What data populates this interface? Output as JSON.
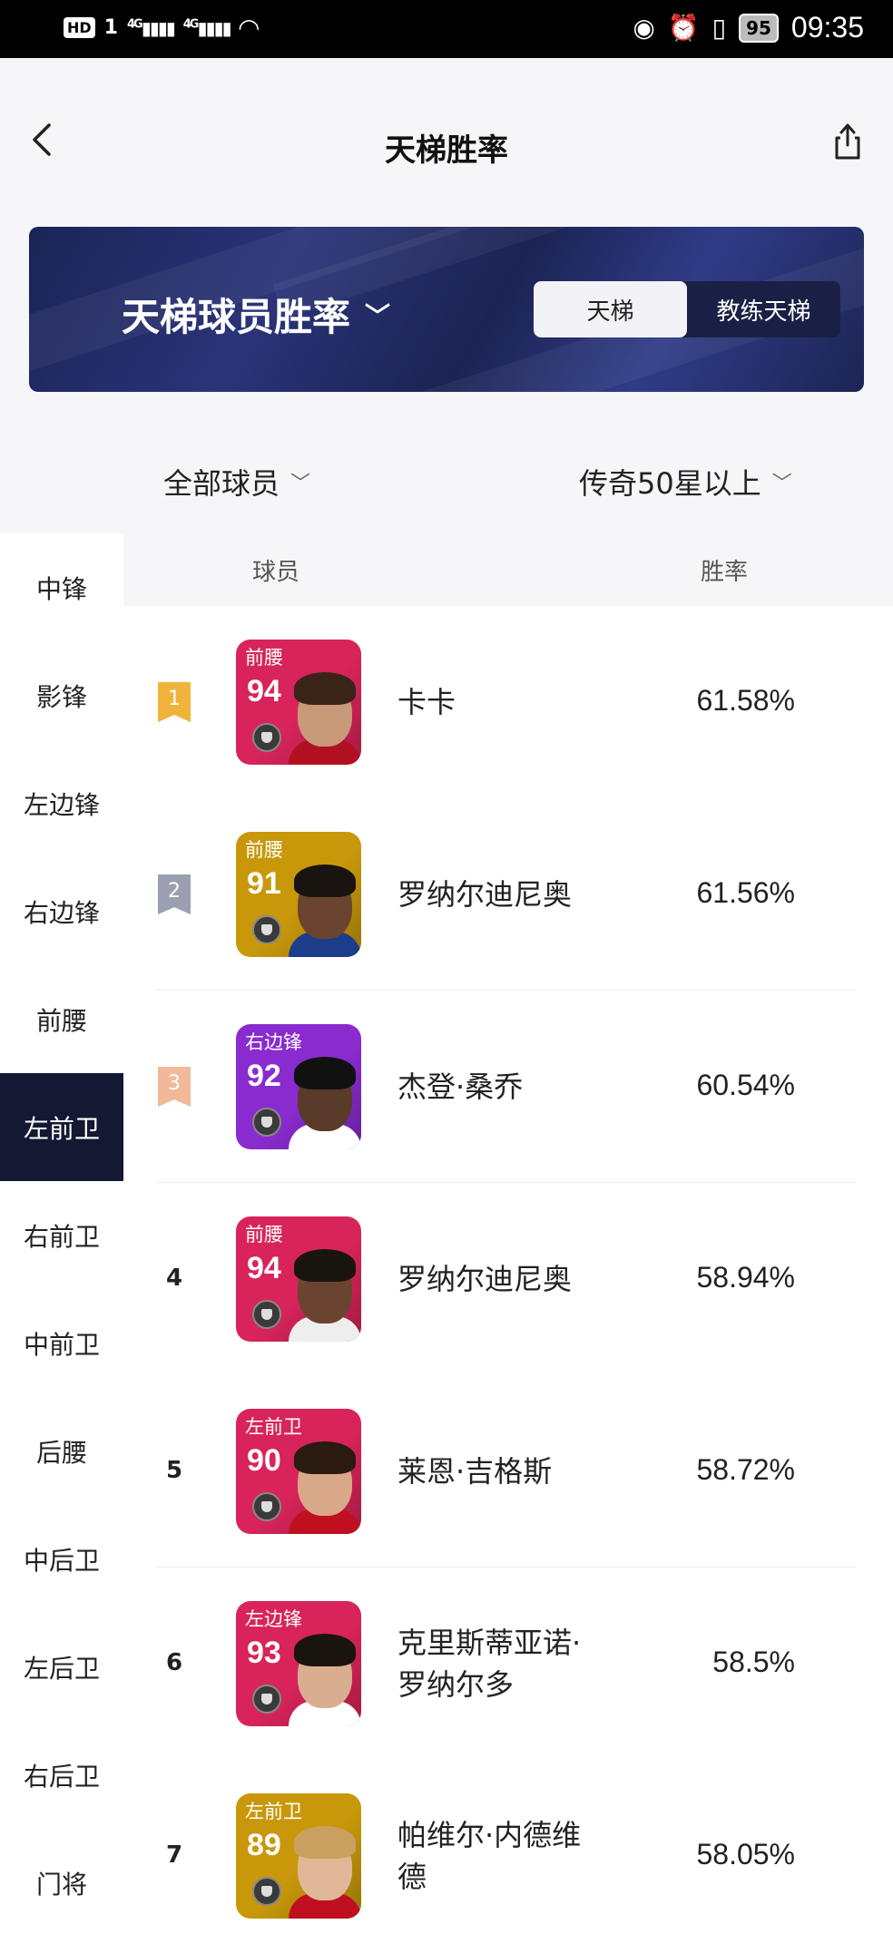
{
  "status_bar": {
    "hd": "HD",
    "sim": "1",
    "signal1": "4G",
    "signal2": "4G",
    "battery": "95",
    "time": "09:35"
  },
  "header": {
    "title": "天梯胜率"
  },
  "banner": {
    "title": "天梯球员胜率",
    "segments": [
      {
        "label": "天梯",
        "active": true
      },
      {
        "label": "教练天梯",
        "active": false
      }
    ]
  },
  "filters": {
    "players": "全部球员",
    "tier": "传奇50星以上"
  },
  "sidebar": {
    "items": [
      {
        "label": "中锋"
      },
      {
        "label": "影锋"
      },
      {
        "label": "左边锋"
      },
      {
        "label": "右边锋"
      },
      {
        "label": "前腰"
      },
      {
        "label": "左前卫"
      },
      {
        "label": "右前卫"
      },
      {
        "label": "中前卫"
      },
      {
        "label": "后腰"
      },
      {
        "label": "中后卫"
      },
      {
        "label": "左后卫"
      },
      {
        "label": "右后卫"
      },
      {
        "label": "门将"
      }
    ],
    "active_index": 5
  },
  "table": {
    "col_player": "球员",
    "col_rate": "胜率",
    "rows": [
      {
        "rank": "1",
        "position": "前腰",
        "rating": "94",
        "name": "卡卡",
        "rate": "61.58%",
        "card_color": "#d8245a",
        "badge_color": "#f0b43c"
      },
      {
        "rank": "2",
        "position": "前腰",
        "rating": "91",
        "name": "罗纳尔迪尼奥",
        "rate": "61.56%",
        "card_color": "#c8980a",
        "badge_color": "#9aa0b0"
      },
      {
        "rank": "3",
        "position": "右边锋",
        "rating": "92",
        "name": "杰登·桑乔",
        "rate": "60.54%",
        "card_color": "#8a2bd0",
        "badge_color": "#f1b89a"
      },
      {
        "rank": "4",
        "position": "前腰",
        "rating": "94",
        "name": "罗纳尔迪尼奥",
        "rate": "58.94%",
        "card_color": "#d8245a",
        "badge_color": ""
      },
      {
        "rank": "5",
        "position": "左前卫",
        "rating": "90",
        "name": "莱恩·吉格斯",
        "rate": "58.72%",
        "card_color": "#d8245a",
        "badge_color": ""
      },
      {
        "rank": "6",
        "position": "左边锋",
        "rating": "93",
        "name": "克里斯蒂亚诺·\n罗纳尔多",
        "rate": "58.5%",
        "card_color": "#d8245a",
        "badge_color": ""
      },
      {
        "rank": "7",
        "position": "左前卫",
        "rating": "89",
        "name": "帕维尔·内德维\n德",
        "rate": "58.05%",
        "card_color": "#c8980a",
        "badge_color": ""
      }
    ]
  }
}
